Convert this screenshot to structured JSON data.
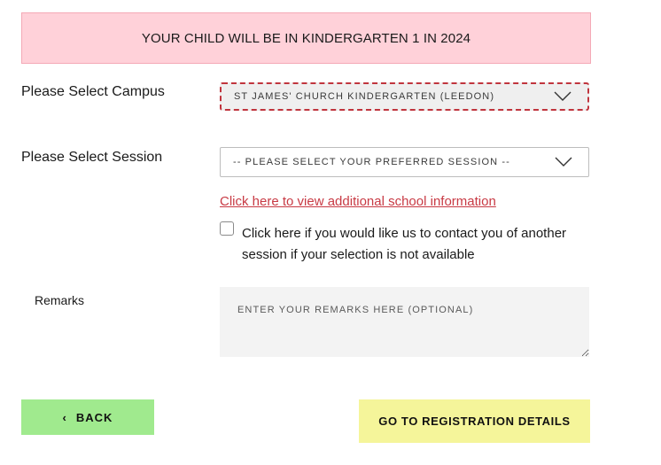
{
  "banner": {
    "text": "YOUR CHILD WILL BE IN KINDERGARTEN 1 IN 2024"
  },
  "campus": {
    "label": "Please Select Campus",
    "selected": "ST JAMES' CHURCH KINDERGARTEN (LEEDON)",
    "icon": "chevron-down-icon"
  },
  "session": {
    "label": "Please Select Session",
    "selected": "-- PLEASE SELECT YOUR PREFERRED SESSION --",
    "icon": "chevron-down-icon"
  },
  "info_link": {
    "text": "Click here to view additional school information"
  },
  "contact_option": {
    "text": "Click here if you would like us to contact you of another session if your selection is not available",
    "checked": false
  },
  "remarks": {
    "label": "Remarks",
    "placeholder": "ENTER YOUR REMARKS HERE (OPTIONAL)",
    "value": ""
  },
  "buttons": {
    "back_icon": "‹",
    "back_label": "BACK",
    "next_label": "GO TO REGISTRATION DETAILS"
  },
  "colors": {
    "banner_bg": "#ffd1d9",
    "link": "#c83a44",
    "back_bg": "#a0ea8e",
    "next_bg": "#f5f59a",
    "error_border": "#c0343d"
  }
}
